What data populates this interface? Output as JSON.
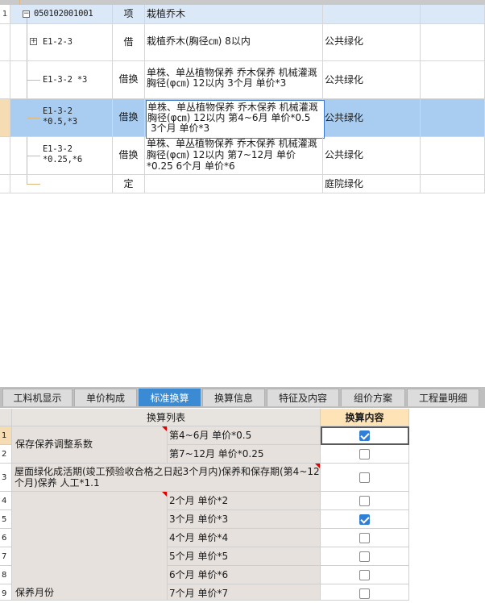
{
  "tree_rows": [
    {
      "num": "1",
      "code": "050102001001",
      "type": "项",
      "name": "栽植乔木",
      "spec": ""
    },
    {
      "num": "",
      "code": "E1-2-3",
      "type": "借",
      "name": "栽植乔木(胸径㎝) 8以内",
      "spec": "公共绿化"
    },
    {
      "num": "",
      "code": "E1-3-2 *3",
      "type": "借换",
      "name": [
        "单株、单丛植物保养 乔木保养 机械灌溉",
        "胸径(φ㎝) 12以内  3个月 单价*3"
      ],
      "spec": "公共绿化"
    },
    {
      "num": "",
      "code": [
        "E1-3-2",
        "*0.5,*3"
      ],
      "type": "借换",
      "name": [
        "单株、单丛植物保养 乔木保养 机械灌溉",
        "胸径(φ㎝) 12以内  第4~6月 单价*0.5",
        "3个月 单价*3"
      ],
      "spec": "公共绿化"
    },
    {
      "num": "",
      "code": [
        "E1-3-2",
        "*0.25,*6"
      ],
      "type": "借换",
      "name": [
        "单株、单丛植物保养 乔木保养 机械灌溉",
        "胸径(φ㎝) 12以内  第7~12月 单价",
        "*0.25  6个月 单价*6"
      ],
      "spec": "公共绿化"
    },
    {
      "num": "",
      "code": "",
      "type": "定",
      "name": "",
      "spec": "庭院绿化"
    }
  ],
  "tabs": [
    "工料机显示",
    "单价构成",
    "标准换算",
    "换算信息",
    "特征及内容",
    "组价方案",
    "工程量明细"
  ],
  "active_tab": "标准换算",
  "lower": {
    "col_list": "换算列表",
    "col_content": "换算内容",
    "group1": "保存保养调整系数",
    "group2": [
      "屋面绿化成活期(竣工预验收合格之日起3个月内)保养和保存期(第4~12",
      "个月)保养 人工*1.1"
    ],
    "group3": "保养月份",
    "rows": [
      {
        "num": "1",
        "label": "第4~6月 单价*0.5",
        "checked": true
      },
      {
        "num": "2",
        "label": "第7~12月 单价*0.25",
        "checked": false
      },
      {
        "num": "3",
        "label": "",
        "checked": false
      },
      {
        "num": "4",
        "label": "2个月 单价*2",
        "checked": false
      },
      {
        "num": "5",
        "label": "3个月 单价*3",
        "checked": true
      },
      {
        "num": "6",
        "label": "4个月 单价*4",
        "checked": false
      },
      {
        "num": "7",
        "label": "5个月 单价*5",
        "checked": false
      },
      {
        "num": "8",
        "label": "6个月 单价*6",
        "checked": false
      },
      {
        "num": "9",
        "label": "7个月 单价*7",
        "checked": false
      }
    ]
  },
  "colors": {
    "accent": "#3a8bd4",
    "selection": "#a9cdf0",
    "header_orange": "#fde3b6"
  }
}
